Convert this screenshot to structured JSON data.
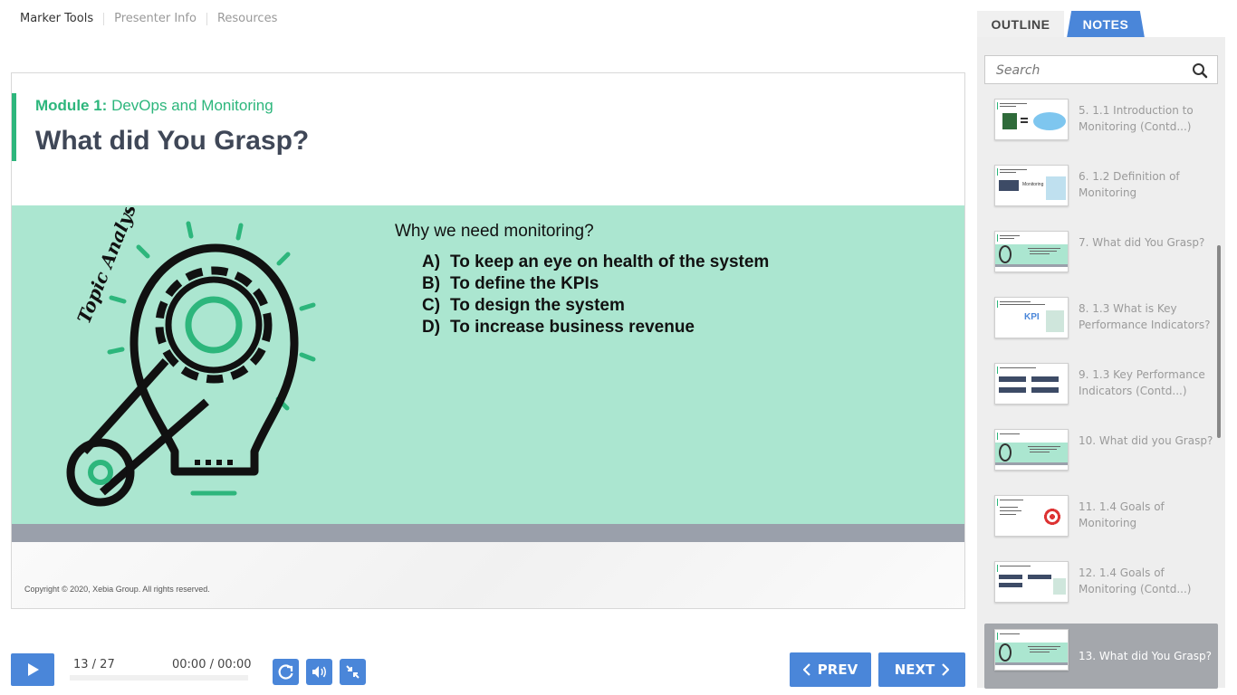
{
  "top_menu": {
    "items": [
      "Marker Tools",
      "Presenter Info",
      "Resources"
    ]
  },
  "slide": {
    "module_label": "Module 1:",
    "module_name": "DevOps and Monitoring",
    "title": "What did You Grasp?",
    "illustration_text": "Topic Analysis",
    "question": "Why we need monitoring?",
    "options": [
      {
        "letter": "A)",
        "text": "To keep an eye on health of the system"
      },
      {
        "letter": "B)",
        "text": "To define the KPIs"
      },
      {
        "letter": "C)",
        "text": "To design the system"
      },
      {
        "letter": "D)",
        "text": "To increase business revenue"
      }
    ],
    "copyright": "Copyright © 2020, Xebia Group. All rights reserved.",
    "thumb_text": "Monitoring",
    "thumb_kpi": "KPI"
  },
  "panel": {
    "tabs": {
      "outline": "OUTLINE",
      "notes": "NOTES"
    },
    "search_placeholder": "Search",
    "items": [
      {
        "label": "5. 1.1 Introduction to Monitoring (Contd...)"
      },
      {
        "label": "6. 1.2 Definition of Monitoring"
      },
      {
        "label": "7. What did You Grasp?"
      },
      {
        "label": "8. 1.3 What is Key Performance Indicators?"
      },
      {
        "label": "9. 1.3 Key Performance Indicators (Contd...)"
      },
      {
        "label": "10. What did you Grasp?"
      },
      {
        "label": "11. 1.4 Goals of Monitoring"
      },
      {
        "label": "12. 1.4 Goals of Monitoring (Contd...)"
      },
      {
        "label": "13. What did You Grasp?"
      }
    ]
  },
  "player": {
    "counter": "13 / 27",
    "timer": "00:00 / 00:00",
    "prev_label": "PREV",
    "next_label": "NEXT",
    "progress": 0.0
  },
  "colors": {
    "accent_green": "#2db67c",
    "band_green": "#abe6d0",
    "button_blue": "#4a86d9",
    "active_item_gray": "#a4a7ac"
  }
}
